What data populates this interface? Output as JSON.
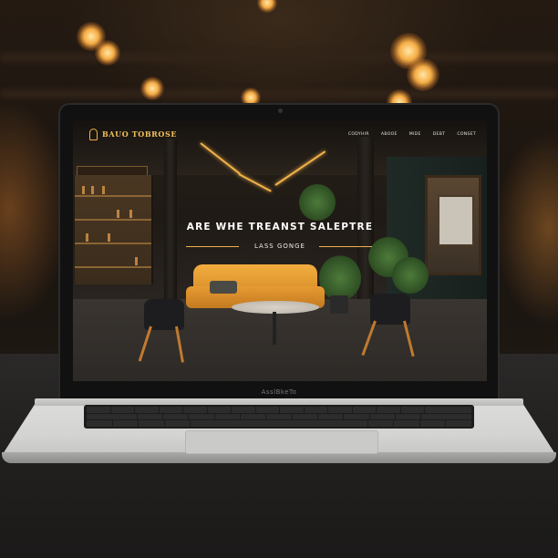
{
  "site": {
    "brand": "BAUO TOBROSE",
    "nav": [
      "CODYHIR",
      "ABOOE",
      "MIDE",
      "DEBT",
      "CONSET"
    ],
    "hero_title": "ARE WHE TREANST SALEPTRE",
    "hero_subtitle": "LASS GONGE"
  },
  "laptop": {
    "hinge_label": "AsslBkeTo"
  },
  "colors": {
    "accent": "#f0b04a",
    "sofa": "#e89b32",
    "plant": "#4d7a3a"
  }
}
